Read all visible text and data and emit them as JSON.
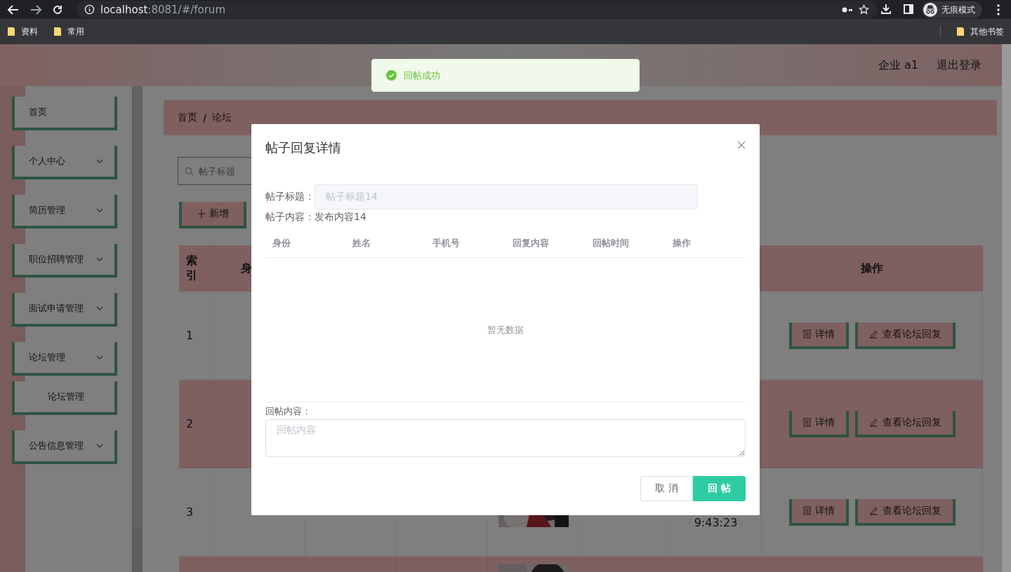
{
  "browser": {
    "url_host": "localhost",
    "url_rest": ":8081/#/forum",
    "profile_label": "无痕模式",
    "bookmarks": [
      "资料",
      "常用"
    ],
    "other_bookmarks": "其他书签"
  },
  "header": {
    "user": "企业 a1",
    "logout": "退出登录"
  },
  "toast": {
    "kind": "success",
    "message": "回帖成功"
  },
  "sidebar": {
    "items": [
      {
        "label": "首页",
        "expandable": false
      },
      {
        "label": "个人中心",
        "expandable": true
      },
      {
        "label": "简历管理",
        "expandable": true
      },
      {
        "label": "职位招聘管理",
        "expandable": true
      },
      {
        "label": "面试申请管理",
        "expandable": true
      },
      {
        "label": "论坛管理",
        "expandable": true,
        "children": [
          {
            "label": "论坛管理"
          }
        ]
      },
      {
        "label": "公告信息管理",
        "expandable": true
      }
    ]
  },
  "breadcrumb": {
    "items": [
      "首页",
      "论坛"
    ],
    "separator": "/"
  },
  "search": {
    "placeholder": "帖子标题"
  },
  "add_button": {
    "label": "新增"
  },
  "table": {
    "columns": [
      "索引",
      "身"
    ],
    "action_column": "操作",
    "rows": [
      {
        "index": "1",
        "actions": [
          "详情",
          "查看论坛回复"
        ]
      },
      {
        "index": "2",
        "actions": [
          "详情",
          "查看论坛回复"
        ]
      },
      {
        "index": "3",
        "time": "9:43:23",
        "photo": {
          "kind": "picture"
        },
        "actions": [
          "详情",
          "查看论坛回复"
        ]
      },
      {
        "photo": {
          "kind": "picture"
        }
      }
    ]
  },
  "dialog": {
    "title": "帖子回复详情",
    "title_field": {
      "label": "帖子标题：",
      "value": "帖子标题14",
      "disabled": true
    },
    "content": {
      "label": "帖子内容：",
      "value": "发布内容14"
    },
    "reply_table": {
      "columns": [
        "身份",
        "姓名",
        "手机号",
        "回复内容",
        "回帖时间",
        "操作"
      ],
      "empty_text": "暂无数据"
    },
    "reply_field": {
      "label": "回帖内容：",
      "placeholder": "回帖内容"
    },
    "buttons": [
      {
        "label": "取 消",
        "kind": "default"
      },
      {
        "label": "回 帖",
        "kind": "primary"
      }
    ]
  }
}
